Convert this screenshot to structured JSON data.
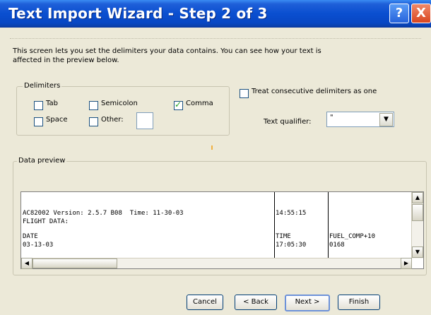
{
  "window": {
    "title": "Text Import Wizard - Step 2 of 3",
    "help_glyph": "?",
    "close_glyph": "X"
  },
  "info_text": "This screen lets you set the delimiters your data contains.  You can see how your text is affected in the preview below.",
  "delimiters": {
    "group_label": "Delimiters",
    "tab": {
      "label": "Tab",
      "checked": false
    },
    "semicolon": {
      "label": "Semicolon",
      "checked": false
    },
    "comma": {
      "label": "Comma",
      "checked": true
    },
    "space": {
      "label": "Space",
      "checked": false
    },
    "other": {
      "label": "Other:",
      "checked": false,
      "value": ""
    }
  },
  "consecutive": {
    "label": "Treat consecutive delimiters as one",
    "checked": false
  },
  "text_qualifier": {
    "label": "Text qualifier:",
    "value": "\""
  },
  "preview": {
    "group_label": "Data preview",
    "rows": [
      [
        "AC82002 Version: 2.5.7 B08  Time: 11-30-03",
        "14:55:15",
        ""
      ],
      [
        "FLIGHT DATA:",
        "",
        ""
      ],
      [
        "DATE",
        "TIME",
        "FUEL_COMP+10"
      ],
      [
        "03-13-03",
        "17:05:30",
        "0168"
      ]
    ]
  },
  "buttons": {
    "cancel": "Cancel",
    "back": "< Back",
    "next": "Next >",
    "finish": "Finish"
  }
}
